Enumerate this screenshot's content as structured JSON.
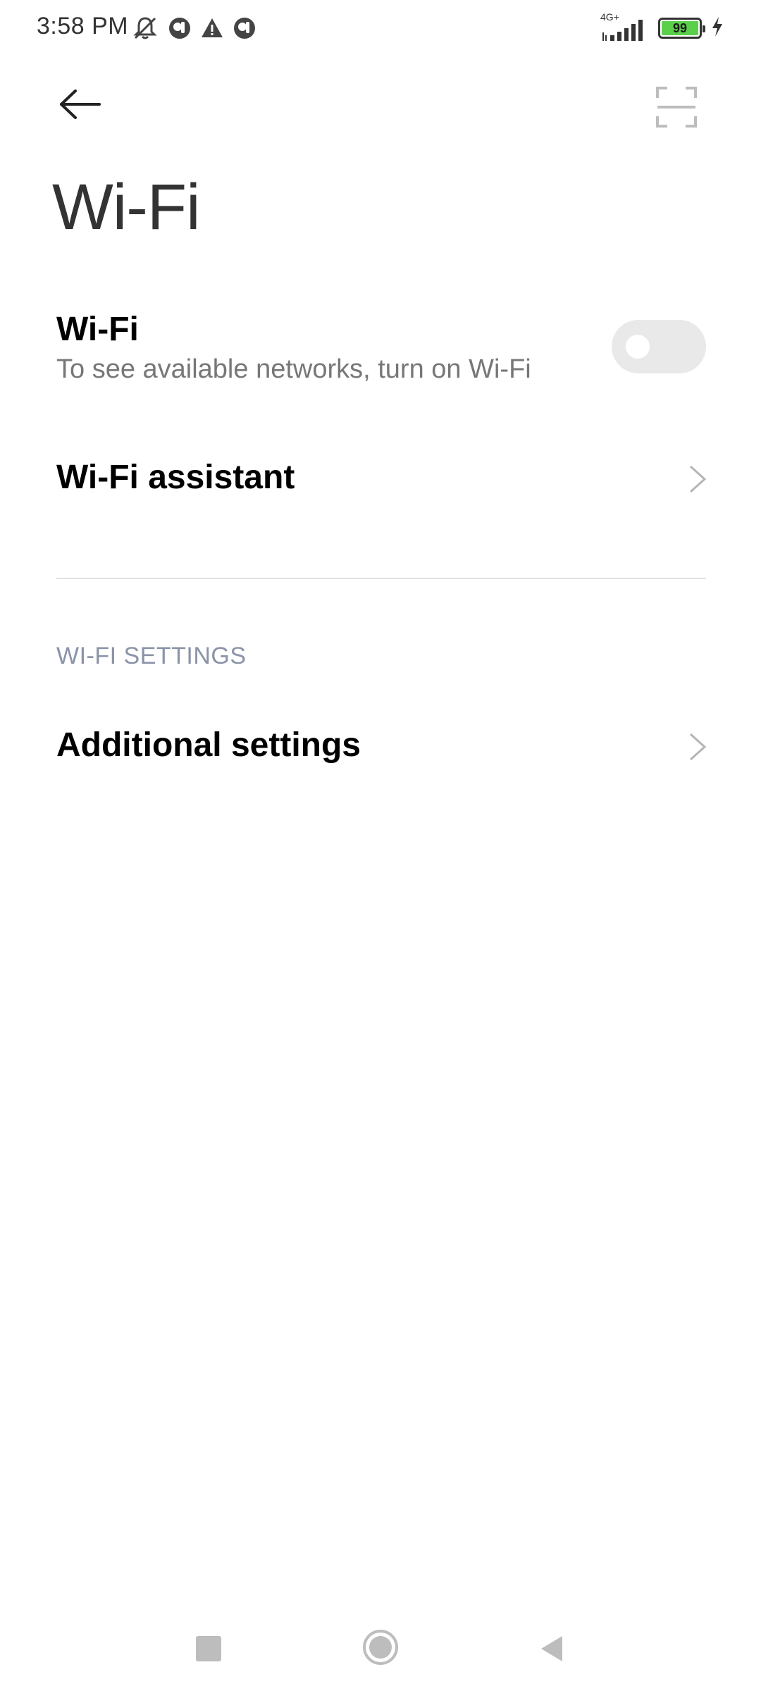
{
  "status_bar": {
    "time": "3:58 PM",
    "network_type": "4G+",
    "battery_level": "99",
    "battery_color": "#5ad04a"
  },
  "header": {
    "back_icon": "arrow-left-icon",
    "scan_icon": "scan-frame-icon",
    "title": "Wi-Fi"
  },
  "wifi_toggle": {
    "title": "Wi-Fi",
    "subtitle": "To see available networks, turn on Wi-Fi",
    "enabled": false
  },
  "wifi_assistant": {
    "title": "Wi-Fi assistant"
  },
  "section": {
    "header": "WI-FI SETTINGS"
  },
  "additional_settings": {
    "title": "Additional settings"
  },
  "nav_bar": {
    "recent_icon": "square-recent-icon",
    "home_icon": "circle-home-icon",
    "back_icon": "triangle-back-icon"
  }
}
